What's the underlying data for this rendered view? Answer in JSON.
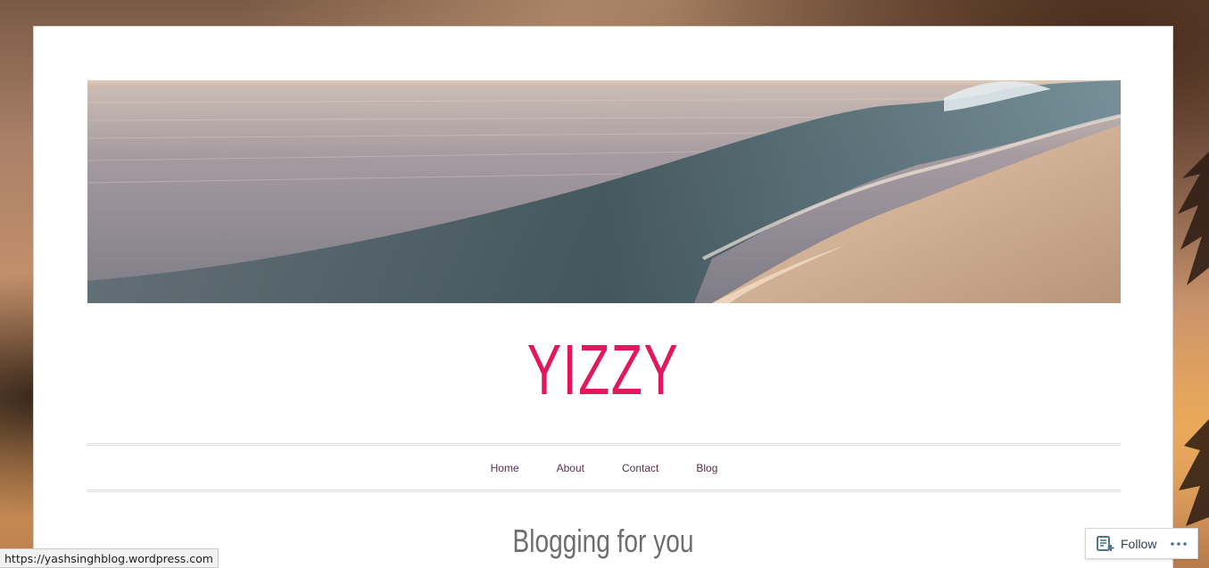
{
  "site": {
    "title": "YIZZY",
    "tagline": "Blogging for you",
    "title_color": "#e3175d"
  },
  "nav": {
    "items": [
      {
        "label": "Home"
      },
      {
        "label": "About"
      },
      {
        "label": "Contact"
      },
      {
        "label": "Blog"
      }
    ]
  },
  "header_image": {
    "icon": "ocean-wave-image"
  },
  "status_bar": {
    "url": "https://yashsinghblog.wordpress.com"
  },
  "follow_widget": {
    "follow_label": "Follow",
    "follow_icon": "reader-follow-icon",
    "more_icon": "ellipsis-icon"
  }
}
